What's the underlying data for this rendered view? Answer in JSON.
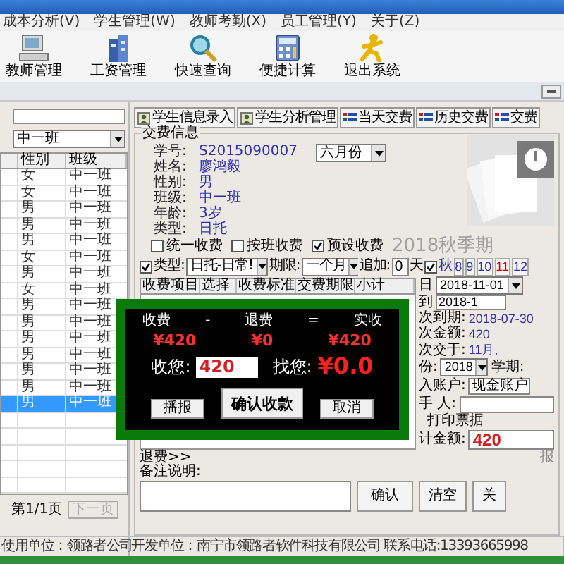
{
  "menu": [
    "成本分析(V)",
    "学生管理(W)",
    "教师考勤(X)",
    "员工管理(Y)",
    "关于(Z)"
  ],
  "toolbar": [
    {
      "label": "教师管理",
      "kind": "computer"
    },
    {
      "label": "工资管理",
      "kind": "building"
    },
    {
      "label": "快速查询",
      "kind": "magnifier"
    },
    {
      "label": "便捷计算",
      "kind": "calculator"
    },
    {
      "label": "退出系统",
      "kind": "runner"
    }
  ],
  "left_panel": {
    "class_select": "中一班",
    "columns": [
      "性别",
      "班级"
    ],
    "rows": [
      {
        "gender": "女",
        "class": "中一班",
        "selected": false
      },
      {
        "gender": "女",
        "class": "中一班",
        "selected": false
      },
      {
        "gender": "男",
        "class": "中一班",
        "selected": false
      },
      {
        "gender": "男",
        "class": "中一班",
        "selected": false
      },
      {
        "gender": "男",
        "class": "中一班",
        "selected": false
      },
      {
        "gender": "女",
        "class": "中一班",
        "selected": false
      },
      {
        "gender": "男",
        "class": "中一班",
        "selected": false
      },
      {
        "gender": "女",
        "class": "中一班",
        "selected": false
      },
      {
        "gender": "男",
        "class": "中一班",
        "selected": false
      },
      {
        "gender": "男",
        "class": "中一班",
        "selected": false
      },
      {
        "gender": "男",
        "class": "中一班",
        "selected": false
      },
      {
        "gender": "男",
        "class": "中一班",
        "selected": false
      },
      {
        "gender": "男",
        "class": "中一班",
        "selected": false
      },
      {
        "gender": "男",
        "class": "中一班",
        "selected": false
      },
      {
        "gender": "男",
        "class": "中一班",
        "selected": true
      }
    ],
    "page": "第1/1页",
    "next_button": {
      "label": "下一页",
      "disabled": true
    }
  },
  "action_buttons": [
    {
      "label": "学生信息录入",
      "kind": "person"
    },
    {
      "label": "学生分析管理",
      "kind": "person"
    },
    {
      "label": "当天交费",
      "kind": "list"
    },
    {
      "label": "历史交费",
      "kind": "list"
    },
    {
      "label": "交费",
      "kind": "list"
    }
  ],
  "fee_info": {
    "title": "交费信息",
    "fields": [
      {
        "label": "学号:",
        "value": "S2015090007"
      },
      {
        "label": "姓名:",
        "value": "廖鸿毅"
      },
      {
        "label": "性别:",
        "value": "男"
      },
      {
        "label": "班级:",
        "value": "中一班"
      },
      {
        "label": "年龄:",
        "value": "3岁"
      },
      {
        "label": "类型:",
        "value": "日托"
      }
    ],
    "month_select": "六月份"
  },
  "options": [
    {
      "label": "统一收费",
      "checked": false
    },
    {
      "label": "按班收费",
      "checked": false
    },
    {
      "label": "预设收费",
      "checked": true
    }
  ],
  "term_label": "2018秋季期",
  "type_row": {
    "type_checked": true,
    "type_label": "类型:",
    "type_value": "日托-日常!",
    "period_label": "期限:",
    "period_value": "一个月",
    "add_label": "追加:",
    "add_value": "0",
    "day_unit": "天",
    "season_checked": true,
    "season_label": "秋",
    "months": [
      {
        "label": "8",
        "selected": false
      },
      {
        "label": "9",
        "selected": false
      },
      {
        "label": "10",
        "selected": false
      },
      {
        "label": "11",
        "selected": true
      },
      {
        "label": "12",
        "selected": false
      }
    ]
  },
  "fee_table": {
    "columns": [
      "收费项目",
      "选择",
      "收费标准",
      "交费期限",
      "小计"
    ]
  },
  "side": {
    "from_label": "日",
    "from_value": "2018-11-01",
    "to_label": "到",
    "to_value": "2018-1",
    "due_label": "次到期:",
    "due_value": "2018-07-30",
    "amount_label": "次金额:",
    "amount_value": "420",
    "paid_label": "次交于:",
    "paid_value": "11月,",
    "year_label": "份:",
    "year_value": "2018",
    "term_label": "学期:",
    "account_label": "入账户:",
    "account_value": "现金账户",
    "handler_label": "手 人:",
    "print_label": "打印票据",
    "total_label": "计金额:",
    "total_value": "420"
  },
  "dialog": {
    "headers": [
      "收费",
      "-",
      "退费",
      "=",
      "实收"
    ],
    "amounts": [
      "¥420",
      "¥0",
      "¥420"
    ],
    "received_label": "收您:",
    "received_value": "420",
    "change_label": "找您:",
    "change_value": "¥0.0",
    "buttons": [
      "播报",
      "确认收款",
      "取消"
    ]
  },
  "refund_link": "退费>>",
  "remark_label": "备注说明:",
  "print_hint": "报",
  "bottom_buttons": [
    "确认",
    "清空",
    "关"
  ],
  "status_bar": [
    "使用单位：领路者公司",
    "开发单位：南宁市领路者软件科技有限公司 联系电话:13393665998"
  ]
}
